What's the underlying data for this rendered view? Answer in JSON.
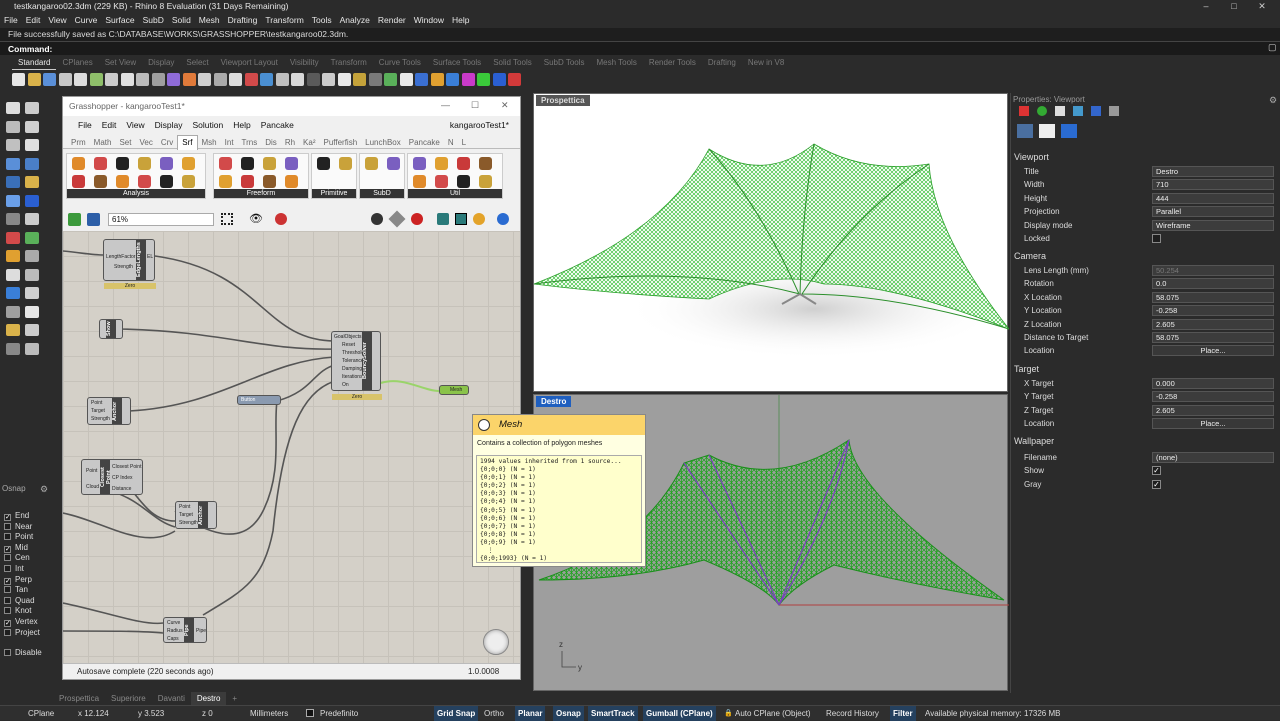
{
  "window": {
    "title": "testkangaroo02.3dm (229 KB) - Rhino 8 Evaluation (31 Days Remaining)"
  },
  "menu": [
    "File",
    "Edit",
    "View",
    "Curve",
    "Surface",
    "SubD",
    "Solid",
    "Mesh",
    "Drafting",
    "Transform",
    "Tools",
    "Analyze",
    "Render",
    "Window",
    "Help"
  ],
  "command": {
    "history": "File successfully saved as C:\\DATABASE\\WORKS\\GRASSHOPPER\\testkangaroo02.3dm.",
    "prompt": "Command:"
  },
  "toolbar_tabs": [
    "Standard",
    "CPlanes",
    "Set View",
    "Display",
    "Select",
    "Viewport Layout",
    "Visibility",
    "Transform",
    "Curve Tools",
    "Surface Tools",
    "Solid Tools",
    "SubD Tools",
    "Mesh Tools",
    "Render Tools",
    "Drafting",
    "New in V8"
  ],
  "osnap": {
    "title": "Osnap",
    "items": [
      {
        "label": "End",
        "on": "✓"
      },
      {
        "label": "Near",
        "on": ""
      },
      {
        "label": "Point",
        "on": ""
      },
      {
        "label": "Mid",
        "on": "✓"
      },
      {
        "label": "Cen",
        "on": ""
      },
      {
        "label": "Int",
        "on": ""
      },
      {
        "label": "Perp",
        "on": "✓"
      },
      {
        "label": "Tan",
        "on": ""
      },
      {
        "label": "Quad",
        "on": ""
      },
      {
        "label": "Knot",
        "on": ""
      },
      {
        "label": "Vertex",
        "on": "✓"
      },
      {
        "label": "Project",
        "on": ""
      }
    ],
    "disable": "Disable"
  },
  "grasshopper": {
    "title": "Grasshopper - kangarooTest1*",
    "menu": [
      "File",
      "Edit",
      "View",
      "Display",
      "Solution",
      "Help",
      "Pancake"
    ],
    "doc_name": "kangarooTest1*",
    "tabs": [
      "Prm",
      "Math",
      "Set",
      "Vec",
      "Crv",
      "Srf",
      "Msh",
      "Int",
      "Trns",
      "Dis",
      "Rh",
      "Ka²",
      "Pufferfish",
      "LunchBox",
      "Pancake",
      "N",
      "L"
    ],
    "active_tab": "Srf",
    "groups": [
      "Analysis",
      "Freeform",
      "Primitive",
      "SubD",
      "Util"
    ],
    "zoom": "61%",
    "status": "Autosave complete (220 seconds ago)",
    "version": "1.0.0008",
    "components": {
      "edge": {
        "name": "EdgeLengths",
        "in": [
          "LengthFactor",
          "Strength"
        ],
        "out": "EL",
        "val": "Zero"
      },
      "show": {
        "name": "Show"
      },
      "solver": {
        "name": "BouncySolver",
        "in": [
          "GoalObjects",
          "Reset",
          "Threshold",
          "Tolerance",
          "Damping",
          "Iterations",
          "On"
        ],
        "val": "Zero"
      },
      "button": {
        "name": "Button"
      },
      "anchor1": {
        "name": "Anchor",
        "in": [
          "Point",
          "Target",
          "Strength"
        ]
      },
      "closest": {
        "name": "Closest Point",
        "in": [
          "Point",
          "Cloud"
        ],
        "out": [
          "Closest Point",
          "CP Index",
          "Distance"
        ]
      },
      "anchor2": {
        "name": "Anchor",
        "in": [
          "Point",
          "Target",
          "Strength"
        ]
      },
      "pipe": {
        "name": "Pipe",
        "in": [
          "Curve",
          "Radius",
          "Caps"
        ],
        "out": "Pipe"
      },
      "mesh": {
        "name": "Mesh"
      }
    }
  },
  "tooltip": {
    "title": "Mesh",
    "desc": "Contains a collection of polygon meshes",
    "lines": [
      "1994 values inherited from 1 source...",
      "{0;0;0} (N = 1)",
      "{0;0;1} (N = 1)",
      "{0;0;2} (N = 1)",
      "{0;0;3} (N = 1)",
      "{0;0;4} (N = 1)",
      "{0;0;5} (N = 1)",
      "{0;0;6} (N = 1)",
      "{0;0;7} (N = 1)",
      "{0;0;8} (N = 1)",
      "{0;0;9} (N = 1)",
      "  ⋮",
      "{0;0;1993} (N = 1)"
    ]
  },
  "viewports": {
    "top": "Prospettica",
    "bottom": "Destro"
  },
  "properties": {
    "header": "Properties: Viewport",
    "sections": {
      "viewport": "Viewport",
      "camera": "Camera",
      "target": "Target",
      "wallpaper": "Wallpaper"
    },
    "viewport_rows": [
      {
        "k": "Title",
        "v": "Destro"
      },
      {
        "k": "Width",
        "v": "710"
      },
      {
        "k": "Height",
        "v": "444"
      },
      {
        "k": "Projection",
        "v": "Parallel"
      },
      {
        "k": "Display mode",
        "v": "Wireframe"
      },
      {
        "k": "Locked",
        "v": ""
      }
    ],
    "camera_rows": [
      {
        "k": "Lens Length (mm)",
        "v": "50.254"
      },
      {
        "k": "Rotation",
        "v": "0.0"
      },
      {
        "k": "X Location",
        "v": "58.075"
      },
      {
        "k": "Y Location",
        "v": "-0.258"
      },
      {
        "k": "Z Location",
        "v": "2.605"
      },
      {
        "k": "Distance to Target",
        "v": "58.075"
      },
      {
        "k": "Location",
        "v": "Place..."
      }
    ],
    "target_rows": [
      {
        "k": "X Target",
        "v": "0.000"
      },
      {
        "k": "Y Target",
        "v": "-0.258"
      },
      {
        "k": "Z Target",
        "v": "2.605"
      },
      {
        "k": "Location",
        "v": "Place..."
      }
    ],
    "wallpaper_rows": [
      {
        "k": "Filename",
        "v": "(none)"
      },
      {
        "k": "Show",
        "v": "✓"
      },
      {
        "k": "Gray",
        "v": "✓"
      }
    ]
  },
  "bottom_tabs": [
    "Prospettica",
    "Superiore",
    "Davanti",
    "Destro",
    "+"
  ],
  "status": {
    "cplane": "CPlane",
    "x": "x 12.124",
    "y": "y 3.523",
    "z": "z 0",
    "units": "Millimeters",
    "layer": "Predefinito",
    "buttons": [
      "Grid Snap",
      "Ortho",
      "Planar",
      "Osnap",
      "SmartTrack",
      "Gumball (CPlane)",
      "Auto CPlane (Object)",
      "Record History",
      "Filter"
    ],
    "memory": "Available physical memory: 17326 MB"
  }
}
